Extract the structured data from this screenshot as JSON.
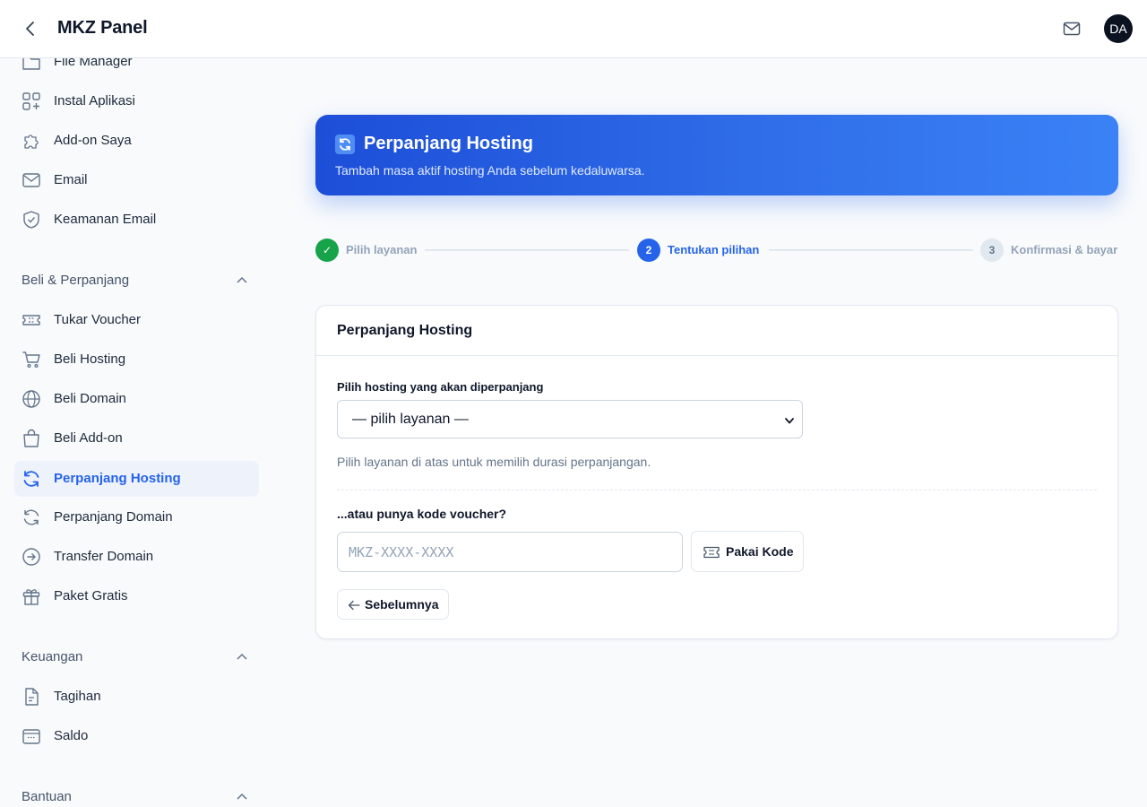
{
  "header": {
    "app_title": "MKZ Panel",
    "avatar_initials": "DA"
  },
  "sidebar": {
    "items_top": [
      {
        "label": "File Manager",
        "icon": "folder-icon"
      },
      {
        "label": "Instal Aplikasi",
        "icon": "apps-plus-icon"
      },
      {
        "label": "Add-on Saya",
        "icon": "puzzle-icon"
      },
      {
        "label": "Email",
        "icon": "mail-icon"
      },
      {
        "label": "Keamanan Email",
        "icon": "shield-check-icon"
      }
    ],
    "section_beli": {
      "title": "Beli & Perpanjang",
      "items": [
        {
          "label": "Tukar Voucher",
          "icon": "ticket-icon"
        },
        {
          "label": "Beli Hosting",
          "icon": "cart-icon"
        },
        {
          "label": "Beli Domain",
          "icon": "globe-icon"
        },
        {
          "label": "Beli Add-on",
          "icon": "bag-icon"
        },
        {
          "label": "Perpanjang Hosting",
          "icon": "refresh-icon",
          "active": true
        },
        {
          "label": "Perpanjang Domain",
          "icon": "refresh-icon"
        },
        {
          "label": "Transfer Domain",
          "icon": "arrow-circle-icon"
        },
        {
          "label": "Paket Gratis",
          "icon": "gift-icon"
        }
      ]
    },
    "section_keuangan": {
      "title": "Keuangan",
      "items": [
        {
          "label": "Tagihan",
          "icon": "document-icon"
        },
        {
          "label": "Saldo",
          "icon": "wallet-icon"
        }
      ]
    },
    "section_bantuan": {
      "title": "Bantuan"
    }
  },
  "hero": {
    "icon": "refresh-emoji-icon",
    "title": "Perpanjang Hosting",
    "subtitle": "Tambah masa aktif hosting Anda sebelum kedaluwarsa."
  },
  "stepper": {
    "steps": [
      {
        "number": "✓",
        "label": "Pilih layanan",
        "state": "done"
      },
      {
        "number": "2",
        "label": "Tentukan pilihan",
        "state": "current"
      },
      {
        "number": "3",
        "label": "Konfirmasi & bayar",
        "state": "todo"
      }
    ]
  },
  "card": {
    "title": "Perpanjang Hosting",
    "select_label": "Pilih hosting yang akan diperpanjang",
    "select_value": "— pilih layanan —",
    "hint": "Pilih layanan di atas untuk memilih durasi perpanjangan.",
    "voucher_label": "...atau punya kode voucher?",
    "voucher_placeholder": "MKZ-XXXX-XXXX",
    "apply_button": "Pakai Kode",
    "prev_button": "Sebelumnya"
  },
  "colors": {
    "accent": "#2563eb",
    "success": "#16a34a",
    "active_bg": "#eef2fb",
    "page_bg": "#f8fafc"
  }
}
